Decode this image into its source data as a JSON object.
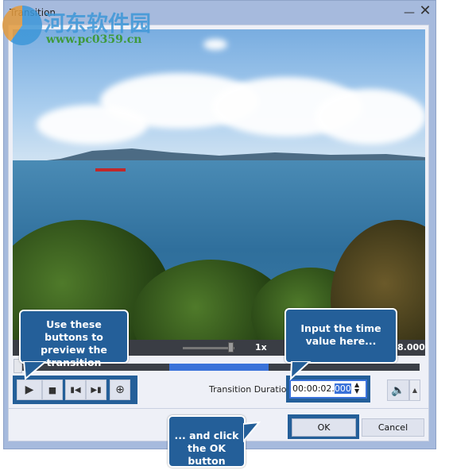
{
  "window": {
    "title": "Transition",
    "minimize_icon": "minimize-icon",
    "close_icon": "close-icon"
  },
  "watermark": {
    "name": "河东软件园",
    "url": "www.pc0359.cn"
  },
  "player": {
    "speed": "1x",
    "end_time": "8.000"
  },
  "controls": {
    "play_icon": "play-icon",
    "stop_icon": "stop-icon",
    "prev_icon": "skip-back-icon",
    "next_icon": "skip-forward-icon",
    "zoom_icon": "zoom-in-icon"
  },
  "duration": {
    "label": "Transition Duration:",
    "value_prefix": "00:00:02.",
    "value_selected": "000"
  },
  "buttons": {
    "ok": "OK",
    "cancel": "Cancel"
  },
  "callouts": {
    "preview": "Use these buttons to preview the transition",
    "time": "Input the time value here...",
    "ok": "... and click the OK button"
  },
  "colors": {
    "accent": "#245f99",
    "selection": "#3a72d9",
    "frame": "#a6badd"
  }
}
